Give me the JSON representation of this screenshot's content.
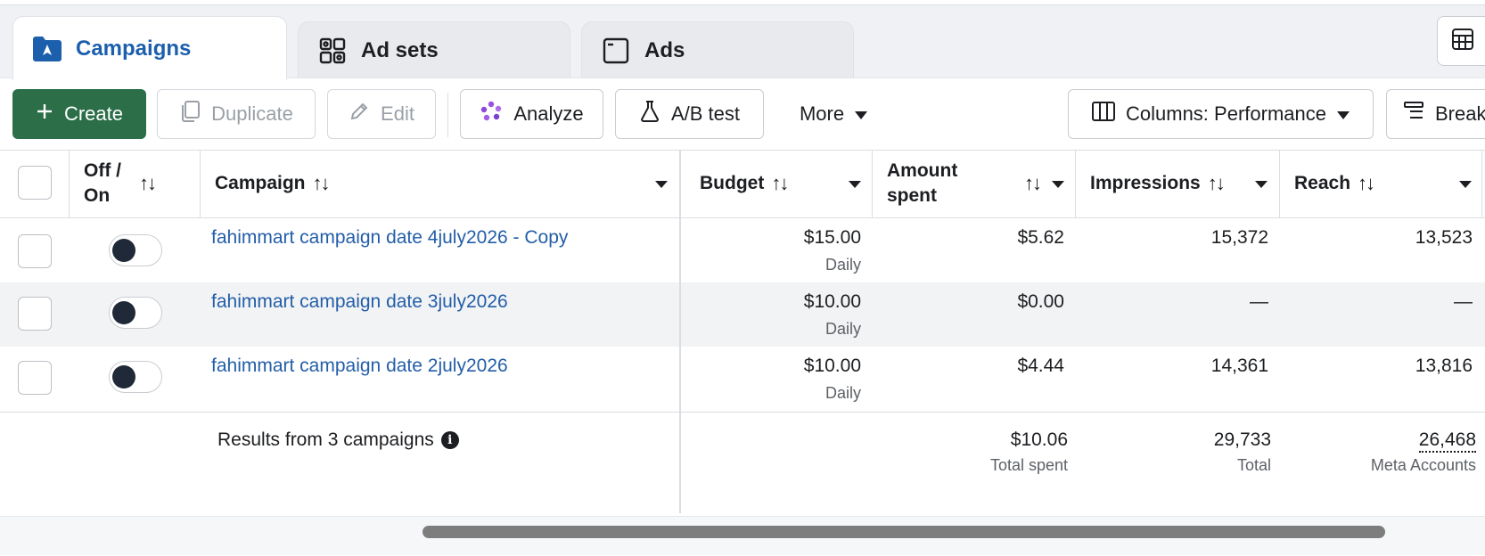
{
  "tabs": [
    {
      "label": "Campaigns",
      "icon": "campaign-folder-icon",
      "active": true
    },
    {
      "label": "Ad sets",
      "icon": "grid-icon",
      "active": false
    },
    {
      "label": "Ads",
      "icon": "ad-window-icon",
      "active": false
    }
  ],
  "toolbar": {
    "create": "Create",
    "duplicate": "Duplicate",
    "edit": "Edit",
    "analyze": "Analyze",
    "ab_test": "A/B test",
    "more": "More",
    "columns": "Columns: Performance",
    "breakdown": "Break"
  },
  "columns": {
    "off_on_line1": "Off /",
    "off_on_line2": "On",
    "campaign": "Campaign",
    "budget": "Budget",
    "amount_spent_line1": "Amount",
    "amount_spent_line2": "spent",
    "impressions": "Impressions",
    "reach": "Reach",
    "sort_glyph": "↑↓"
  },
  "rows": [
    {
      "name": "fahimmart campaign date 4july2026 - Copy",
      "budget": "$15.00",
      "budget_type": "Daily",
      "amount_spent": "$5.62",
      "impressions": "15,372",
      "reach": "13,523"
    },
    {
      "name": "fahimmart campaign date 3july2026",
      "budget": "$10.00",
      "budget_type": "Daily",
      "amount_spent": "$0.00",
      "impressions": "—",
      "reach": "—"
    },
    {
      "name": "fahimmart campaign date 2july2026",
      "budget": "$10.00",
      "budget_type": "Daily",
      "amount_spent": "$4.44",
      "impressions": "14,361",
      "reach": "13,816"
    }
  ],
  "summary": {
    "label": "Results from 3 campaigns",
    "amount_spent": "$10.06",
    "amount_spent_sub": "Total spent",
    "impressions": "29,733",
    "impressions_sub": "Total",
    "reach": "26,468",
    "reach_sub": "Meta Accounts"
  },
  "colors": {
    "accent": "#235ea8",
    "create_green": "#2b6e48"
  }
}
